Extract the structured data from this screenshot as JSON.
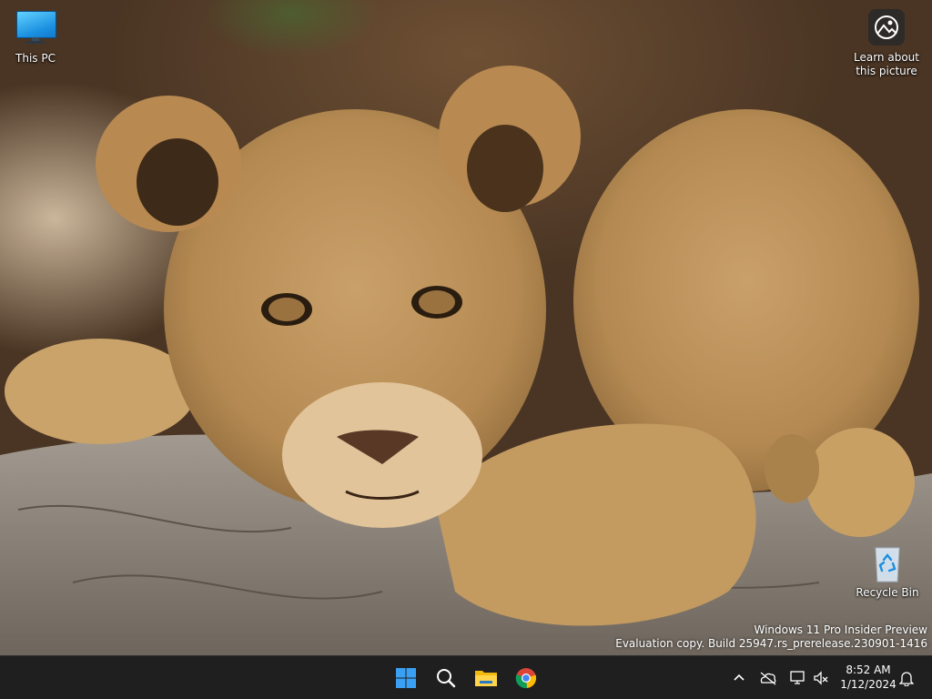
{
  "desktop": {
    "icons": [
      {
        "label": "This PC",
        "icon": "this-pc-icon"
      },
      {
        "label": "Learn about\nthis picture",
        "line1": "Learn about",
        "line2": "this picture",
        "icon": "learn-about-picture-icon"
      },
      {
        "label": "Recycle Bin",
        "icon": "recycle-bin-icon"
      }
    ]
  },
  "watermark": {
    "line1": "Windows 11 Pro Insider Preview",
    "line2": "Evaluation copy. Build 25947.rs_prerelease.230901-1416"
  },
  "taskbar": {
    "apps": [
      {
        "name": "Start",
        "icon": "windows-start-icon"
      },
      {
        "name": "Search",
        "icon": "search-icon"
      },
      {
        "name": "File Explorer",
        "icon": "folder-icon"
      },
      {
        "name": "Google Chrome",
        "icon": "chrome-icon"
      }
    ],
    "tray": {
      "icons": [
        "chevron-up-icon",
        "network-icon",
        "display-icon",
        "volume-muted-icon",
        "notification-bell-icon"
      ],
      "time": "8:52 AM",
      "date": "1/12/2024"
    },
    "accent": "#1f1f1f"
  }
}
